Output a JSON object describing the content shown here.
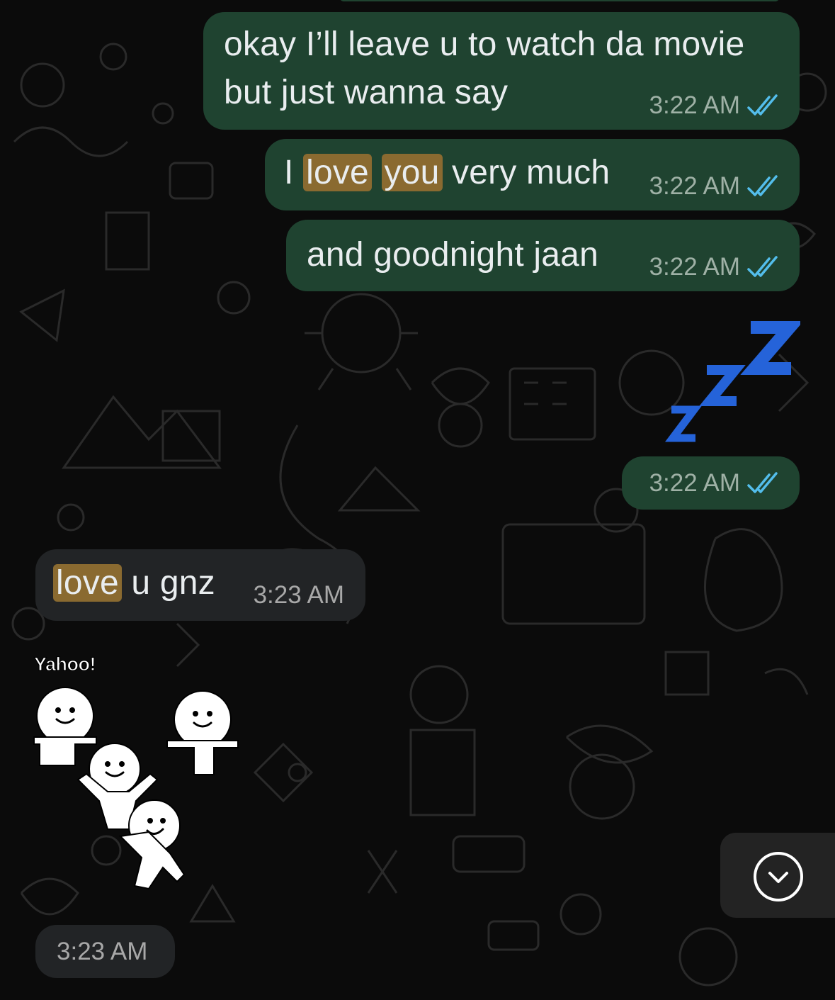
{
  "messages": [
    {
      "direction": "outgoing",
      "text_line1": "okay I’ll leave u to watch da movie",
      "text_line2": "but just wanna say",
      "time": "3:22 AM",
      "status": "read-double-tick"
    },
    {
      "direction": "outgoing",
      "parts": [
        "I",
        "love",
        "you",
        "very much"
      ],
      "highlighted": [
        "love",
        "you"
      ],
      "time": "3:22 AM",
      "status": "read-double-tick"
    },
    {
      "direction": "outgoing",
      "text": "and goodnight jaan",
      "time": "3:22 AM",
      "status": "read-double-tick"
    },
    {
      "direction": "outgoing",
      "emoji": "zzz-emoji",
      "time": "3:22 AM",
      "status": "read-double-tick"
    },
    {
      "direction": "incoming",
      "parts": [
        "love",
        "u gnz"
      ],
      "highlighted": [
        "love"
      ],
      "time": "3:23 AM"
    },
    {
      "direction": "incoming",
      "sticker": "dancing-figures-sticker",
      "sticker_text": "Yahoo!",
      "time": "3:23 AM"
    }
  ],
  "icons": {
    "read_receipt": "double-check-icon",
    "scroll_down": "chevron-down-circle-icon"
  },
  "colors": {
    "outgoing_bubble": "#1f4330",
    "incoming_bubble": "#222426",
    "highlight": "#8a6a30",
    "read_tick": "#53bdeb",
    "zzz_blue": "#2563d9"
  }
}
